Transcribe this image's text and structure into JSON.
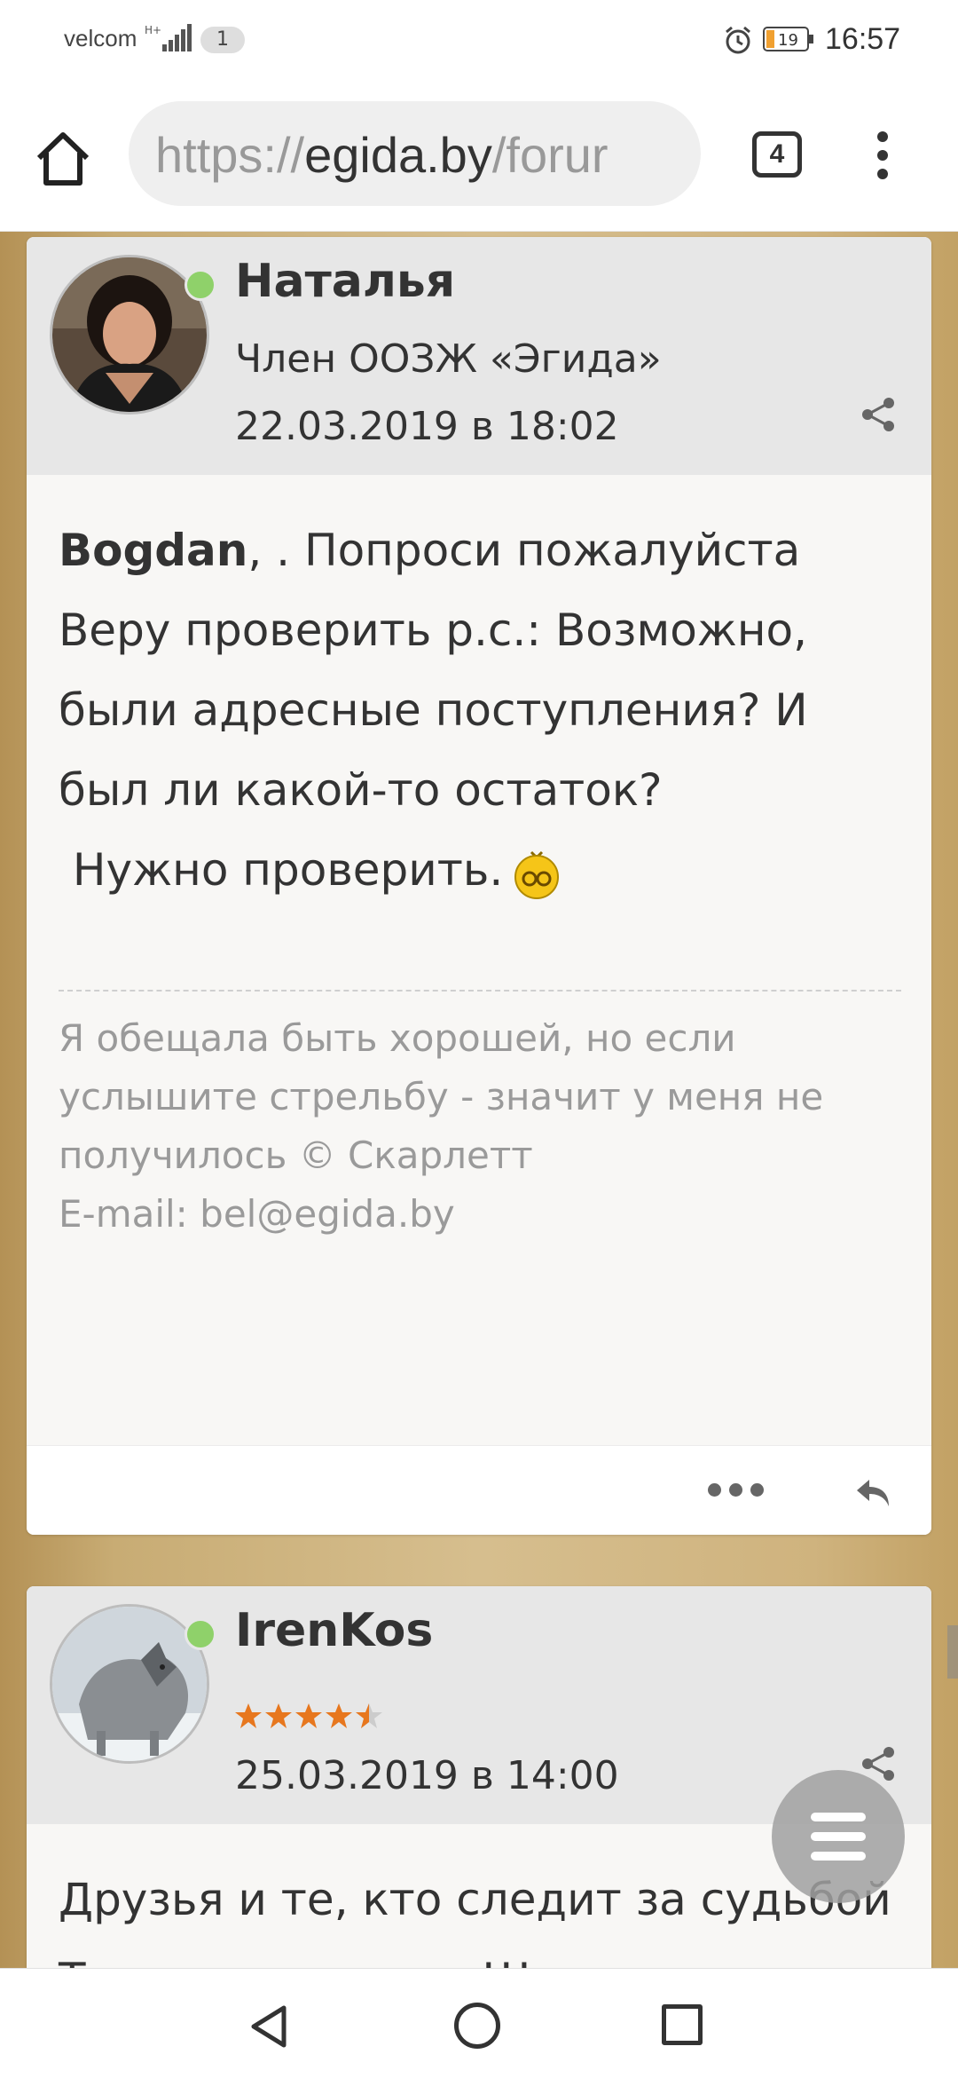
{
  "status_bar": {
    "carrier": "velcom",
    "notification_count": "1",
    "battery_level": "19",
    "time": "16:57"
  },
  "browser": {
    "url_scheme": "https://",
    "url_domain": "egida.by",
    "url_rest": "/forur",
    "tab_count": "4"
  },
  "posts": [
    {
      "author": "Наталья",
      "role": "Член ООЗЖ «Эгида»",
      "date": "22.03.2019 в 18:02",
      "online": true,
      "body_mention": "Bogdan",
      "body_text": ", . Попроси пожалуйста Веру проверить р.с.: Возможно, были адресные поступления? И был ли какой-то остаток?",
      "body_text2": " Нужно проверить.",
      "signature_line1": "Я обещала быть хорошей, но если услышите стрельбу - значит у меня не получилось © Скарлетт",
      "signature_line2": "E-mail: bel@egida.by"
    },
    {
      "author": "IrenKos",
      "rating": 4.5,
      "date": "25.03.2019 в 14:00",
      "online": true,
      "body_text": "Друзья и те, кто следит за судьбой Тимура, помогите!!!"
    }
  ],
  "colors": {
    "online": "#8fd16a",
    "star": "#e7771e"
  }
}
